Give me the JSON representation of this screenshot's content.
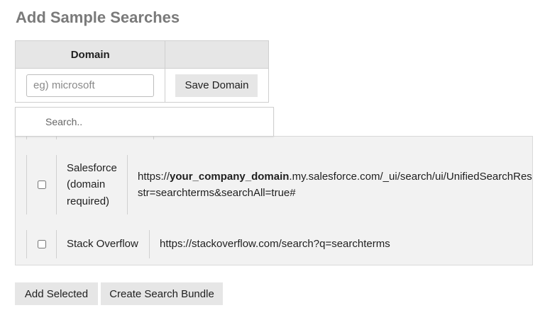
{
  "page": {
    "title": "Add Sample Searches"
  },
  "domain_table": {
    "header_domain": "Domain",
    "header_action": "",
    "input_placeholder": "eg) microsoft",
    "input_value": "",
    "save_label": "Save Domain"
  },
  "search": {
    "placeholder": "Search..",
    "value": ""
  },
  "results": [
    {
      "checked": false,
      "name": "Salesforce (domain required)",
      "url_prefix": "https://",
      "url_bold": "your_company_domain",
      "url_suffix": ".my.salesforce.com/_ui/search/ui/UnifiedSearchResu",
      "url_line2": "str=searchterms&searchAll=true#"
    },
    {
      "checked": false,
      "name": "Stack Overflow",
      "url": "https://stackoverflow.com/search?q=searchterms"
    }
  ],
  "actions": {
    "add_selected": "Add Selected",
    "create_bundle": "Create Search Bundle"
  }
}
